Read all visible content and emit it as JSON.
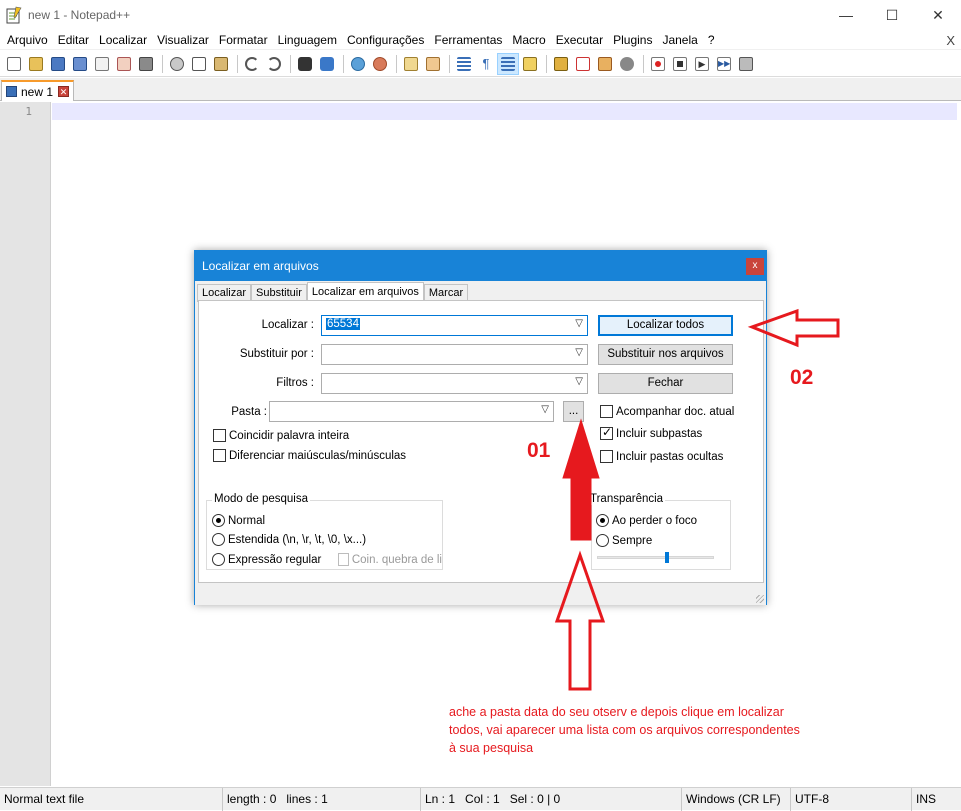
{
  "window": {
    "title": "new 1 - Notepad++",
    "app_icon": "notepadpp-icon",
    "buttons": {
      "minimize": "—",
      "maximize": "☐",
      "close": "✕"
    }
  },
  "menu": {
    "items": [
      "Arquivo",
      "Editar",
      "Localizar",
      "Visualizar",
      "Formatar",
      "Linguagem",
      "Configurações",
      "Ferramentas",
      "Macro",
      "Executar",
      "Plugins",
      "Janela",
      "?"
    ],
    "close_doc": "X"
  },
  "toolbar": {
    "icons": [
      "new-file-icon",
      "open-file-icon",
      "save-icon",
      "save-all-icon",
      "close-icon",
      "close-all-icon",
      "print-icon",
      "cut-icon",
      "copy-icon",
      "paste-icon",
      "undo-icon",
      "redo-icon",
      "find-icon",
      "replace-icon",
      "zoom-in-icon",
      "zoom-out-icon",
      "sync-vertical-icon",
      "sync-horizontal-icon",
      "word-wrap-icon",
      "show-all-chars-icon",
      "indent-guide-icon",
      "user-language-icon",
      "document-map-icon",
      "function-list-icon",
      "folder-workspace-icon",
      "monitoring-icon",
      "record-macro-icon",
      "stop-macro-icon",
      "play-macro-icon",
      "run-macro-multiple-icon",
      "save-macro-icon"
    ]
  },
  "tabs": [
    {
      "label": "new 1"
    }
  ],
  "editor": {
    "line_numbers": [
      "1"
    ]
  },
  "dialog": {
    "title": "Localizar em arquivos",
    "close": "x",
    "tabs": [
      "Localizar",
      "Substituir",
      "Localizar em arquivos",
      "Marcar"
    ],
    "active_tab": "Localizar em arquivos",
    "fields": {
      "find": {
        "label": "Localizar :",
        "value": "65534"
      },
      "replace": {
        "label": "Substituir por :",
        "value": ""
      },
      "filters": {
        "label": "Filtros :",
        "value": ""
      },
      "folder": {
        "label": "Pasta :",
        "value": "",
        "browse": "..."
      }
    },
    "buttons": {
      "find_all": "Localizar todos",
      "replace_in_files": "Substituir nos arquivos",
      "close": "Fechar"
    },
    "checkboxes": {
      "match_whole_word": "Coincidir palavra inteira",
      "match_case": "Diferenciar maiúsculas/minúsculas",
      "follow_current_doc": "Acompanhar doc. atual",
      "include_subfolders": "Incluir subpastas",
      "include_hidden": "Incluir pastas ocultas"
    },
    "search_mode": {
      "legend": "Modo de pesquisa",
      "normal": "Normal",
      "extended": "Estendida  (\\n, \\r, \\t, \\0, \\x...)",
      "regex": "Expressão regular",
      "dot_newline": "Coin. quebra de li"
    },
    "transparency": {
      "legend": "Transparência",
      "on_focus_lost": "Ao perder o foco",
      "always": "Sempre",
      "level": 0.6
    }
  },
  "annotations": {
    "step1": "01",
    "step2": "02",
    "note": "ache a pasta data do seu otserv e depois clique em localizar todos, vai aparecer uma lista com os arquivos correspondentes à sua pesquisa",
    "color": "#e6191e"
  },
  "statusbar": {
    "file_type": "Normal text file",
    "length": "length : 0",
    "lines": "lines : 1",
    "ln": "Ln : 1",
    "col": "Col : 1",
    "sel": "Sel : 0 | 0",
    "eol": "Windows (CR LF)",
    "encoding": "UTF-8",
    "mode": "INS"
  }
}
